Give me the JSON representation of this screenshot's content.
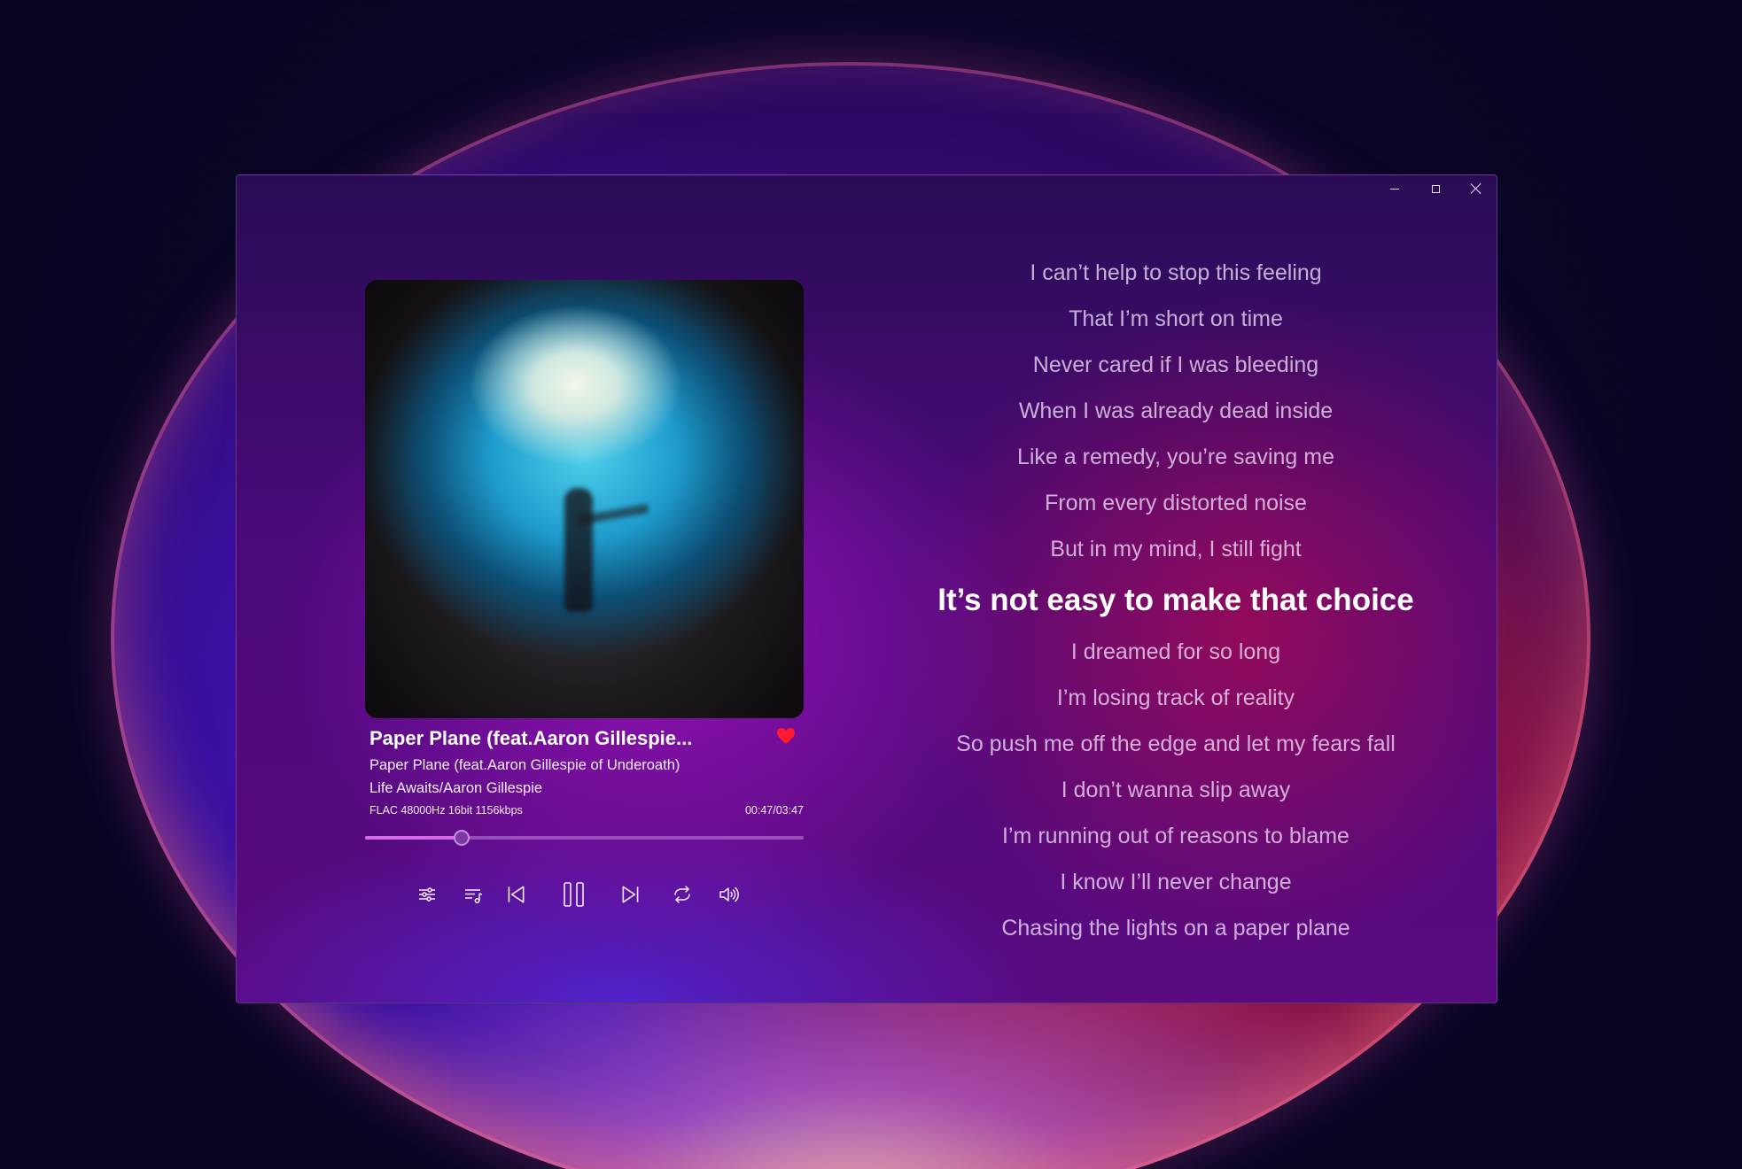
{
  "window": {
    "controls": {
      "minimize": "minimize-icon",
      "maximize": "maximize-icon",
      "close": "close-icon"
    }
  },
  "track": {
    "title": "Paper Plane (feat.Aaron Gillespie...",
    "subtitle": "Paper Plane (feat.Aaron Gillespie of Underoath)",
    "album_artist": "Life Awaits/Aaron Gillespie",
    "format": "FLAC 48000Hz 16bit 1156kbps",
    "time": "00:47/03:47",
    "progress_fraction": 0.22,
    "favorited": true,
    "favorite_color": "#ff1a2e"
  },
  "controls": {
    "equalizer": "equalizer-icon",
    "playlist": "playlist-icon",
    "previous": "previous-icon",
    "play_pause": "pause-icon",
    "next": "next-icon",
    "repeat": "repeat-icon",
    "volume": "volume-icon"
  },
  "lyrics": {
    "lines": [
      "I can’t help to stop this feeling",
      "That I’m short on time",
      "Never cared if I was bleeding",
      "When I was already dead inside",
      "Like a remedy, you’re saving me",
      "From every distorted noise",
      "But in my mind, I still fight",
      "It’s not easy to make that choice",
      "I dreamed for so long",
      "I’m losing track of reality",
      "So push me off the edge and let my fears fall",
      "I don’t wanna slip away",
      "I’m running out of reasons to blame",
      "I know I’ll never change",
      "Chasing the lights on a paper plane"
    ],
    "current_index": 7
  }
}
